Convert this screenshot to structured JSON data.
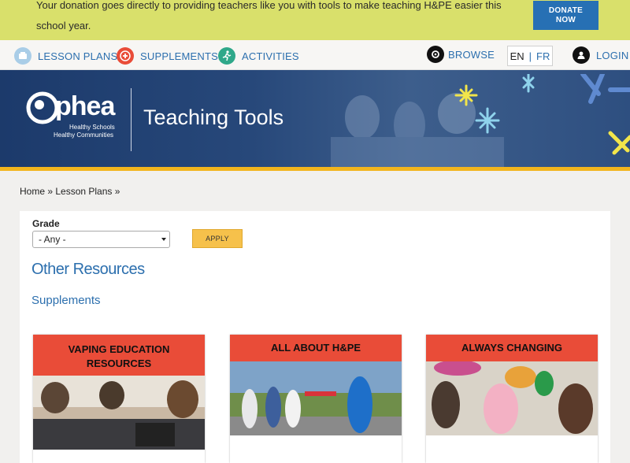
{
  "donate_bar": {
    "message": "Your donation goes directly to providing teachers like you with tools to make teaching H&PE easier this school year.",
    "button_label": "DONATE NOW"
  },
  "nav": {
    "items": [
      {
        "label": "LESSON PLANS",
        "icon": "lesson-plans-icon"
      },
      {
        "label": "SUPPLEMENTS",
        "icon": "plus-icon"
      },
      {
        "label": "ACTIVITIES",
        "icon": "runner-icon"
      }
    ],
    "browse_label": "BROWSE",
    "lang_en": "EN",
    "lang_sep": "|",
    "lang_fr": "FR",
    "login_label": "LOGIN"
  },
  "hero": {
    "logo_word": "phea",
    "logo_tag1": "Healthy Schools",
    "logo_tag2": "Healthy Communities",
    "title": "Teaching Tools"
  },
  "breadcrumb": "Home » Lesson Plans »",
  "filter": {
    "grade_label": "Grade",
    "grade_value": "- Any -",
    "apply_label": "APPLY"
  },
  "sections": {
    "other_resources": "Other Resources",
    "supplements": "Supplements"
  },
  "cards": [
    {
      "title": "VAPING EDUCATION RESOURCES"
    },
    {
      "title": "ALL ABOUT H&PE"
    },
    {
      "title": "ALWAYS CHANGING"
    }
  ],
  "colors": {
    "donate_bar": "#d9e06b",
    "brand_blue": "#2770b4",
    "accent_yellow": "#f2b51d",
    "card_red": "#e94c38"
  }
}
